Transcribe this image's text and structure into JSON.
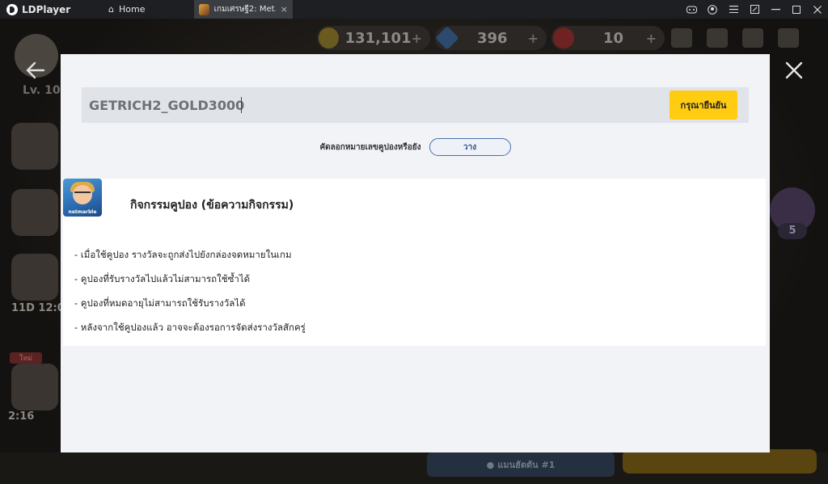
{
  "titlebar": {
    "app_name": "LDPlayer",
    "home_tab": "Home",
    "game_tab": "เกมเศรษฐี2: Met...",
    "tab_close": "×",
    "controls": [
      "gamepad-icon",
      "user-icon",
      "menu-icon",
      "window-shrink-icon",
      "minimize-icon",
      "maximize-icon",
      "close-icon"
    ]
  },
  "game": {
    "gold": "131,101",
    "gems": "396",
    "rubies": "10",
    "level": "Lv. 10",
    "timer": "11D 12:0",
    "timer2": "2:16",
    "tag": "ใหม่",
    "badge_count": "5",
    "bottom_label": "แมนฮัตตัน #1",
    "plus": "+"
  },
  "modal": {
    "coupon_value": "GETRICH2_GOLD3000",
    "confirm_label": "กรุณายืนยัน",
    "paste_prompt": "คัดลอกหมายเลขคูปองหรือยัง",
    "paste_label": "วาง",
    "app_icon_brand": "netmarble",
    "event_title": "กิจกรรมคูปอง (ข้อความกิจกรรม)",
    "notes": [
      "- เมื่อใช้คูปอง รางวัลจะถูกส่งไปยังกล่องจดหมายในเกม",
      "- คูปองที่รับรางวัลไปแล้วไม่สามารถใช้ซ้ำได้",
      "- คูปองที่หมดอายุไม่สามารถใช้รับรางวัลได้",
      "- หลังจากใช้คูปองแล้ว อาจจะต้องรอการจัดส่งรางวัลสักครู่"
    ]
  },
  "colors": {
    "confirm_button": "#ffcc12",
    "modal_background": "#f1f3f6",
    "paste_border": "#4a6fa8"
  }
}
